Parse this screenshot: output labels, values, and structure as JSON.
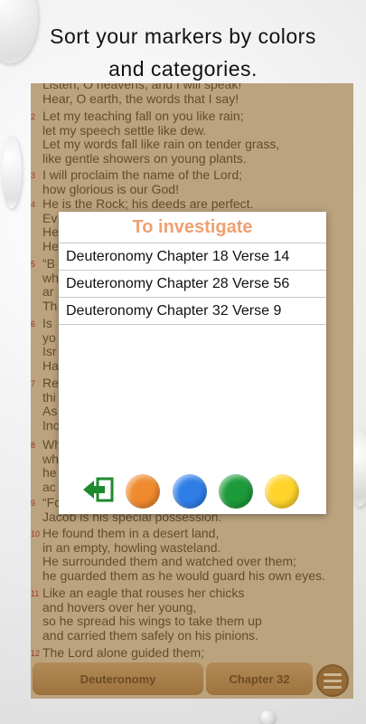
{
  "caption": {
    "line1": "Sort your markers by colors",
    "line2": "and categories."
  },
  "reader": {
    "verses": [
      {
        "num": "",
        "lines": [
          "Listen, O heavens, and I will speak!",
          "Hear, O earth, the words that I say!"
        ]
      },
      {
        "num": "2",
        "lines": [
          "Let my teaching fall on you like rain;",
          "let my speech settle like dew.",
          "Let my words fall like rain on tender grass,",
          "like gentle showers on young plants."
        ]
      },
      {
        "num": "3",
        "lines": [
          "I will proclaim the name of the Lord;",
          "how glorious is our God!"
        ]
      },
      {
        "num": "4",
        "lines": [
          "He is the Rock; his deeds are perfect.",
          "Ev",
          "He",
          "He"
        ]
      },
      {
        "num": "5",
        "lines": [
          "“B",
          "wh",
          "ar",
          "Th"
        ]
      },
      {
        "num": "6",
        "lines": [
          "Is",
          "yo",
          "Isr",
          "Ha"
        ]
      },
      {
        "num": "7",
        "lines": [
          "Re",
          "thi",
          "As",
          "Inc"
        ]
      },
      {
        "num": "8",
        "lines": [
          "Wh",
          "wh",
          "he",
          "ac"
        ]
      },
      {
        "num": "9",
        "lines": [
          "“Fo",
          "Jacob is his special possession."
        ]
      },
      {
        "num": "10",
        "lines": [
          "He found them in a desert land,",
          "in an empty, howling wasteland.",
          "He surrounded them and watched over them;",
          "he guarded them as he would guard his own eyes."
        ]
      },
      {
        "num": "11",
        "lines": [
          "Like an eagle that rouses her chicks",
          "and hovers over her young,",
          "so he spread his wings to take them up",
          "and carried them safely on his pinions."
        ]
      },
      {
        "num": "12",
        "lines": [
          "The Lord alone guided them;"
        ]
      }
    ],
    "book_button": "Deuteronomy",
    "chapter_button": "Chapter 32"
  },
  "dialog": {
    "title": "To investigate",
    "markers": [
      "Deuteronomy Chapter 18 Verse 14",
      "Deuteronomy Chapter 28 Verse 56",
      "Deuteronomy Chapter 32 Verse 9"
    ],
    "colors": [
      {
        "name": "orange",
        "hex": "#f08a2e"
      },
      {
        "name": "blue",
        "hex": "#2f7ee8"
      },
      {
        "name": "green",
        "hex": "#1d9a3a"
      },
      {
        "name": "yellow",
        "hex": "#ffd42a"
      }
    ],
    "export_icon": "exit-arrow-icon"
  }
}
